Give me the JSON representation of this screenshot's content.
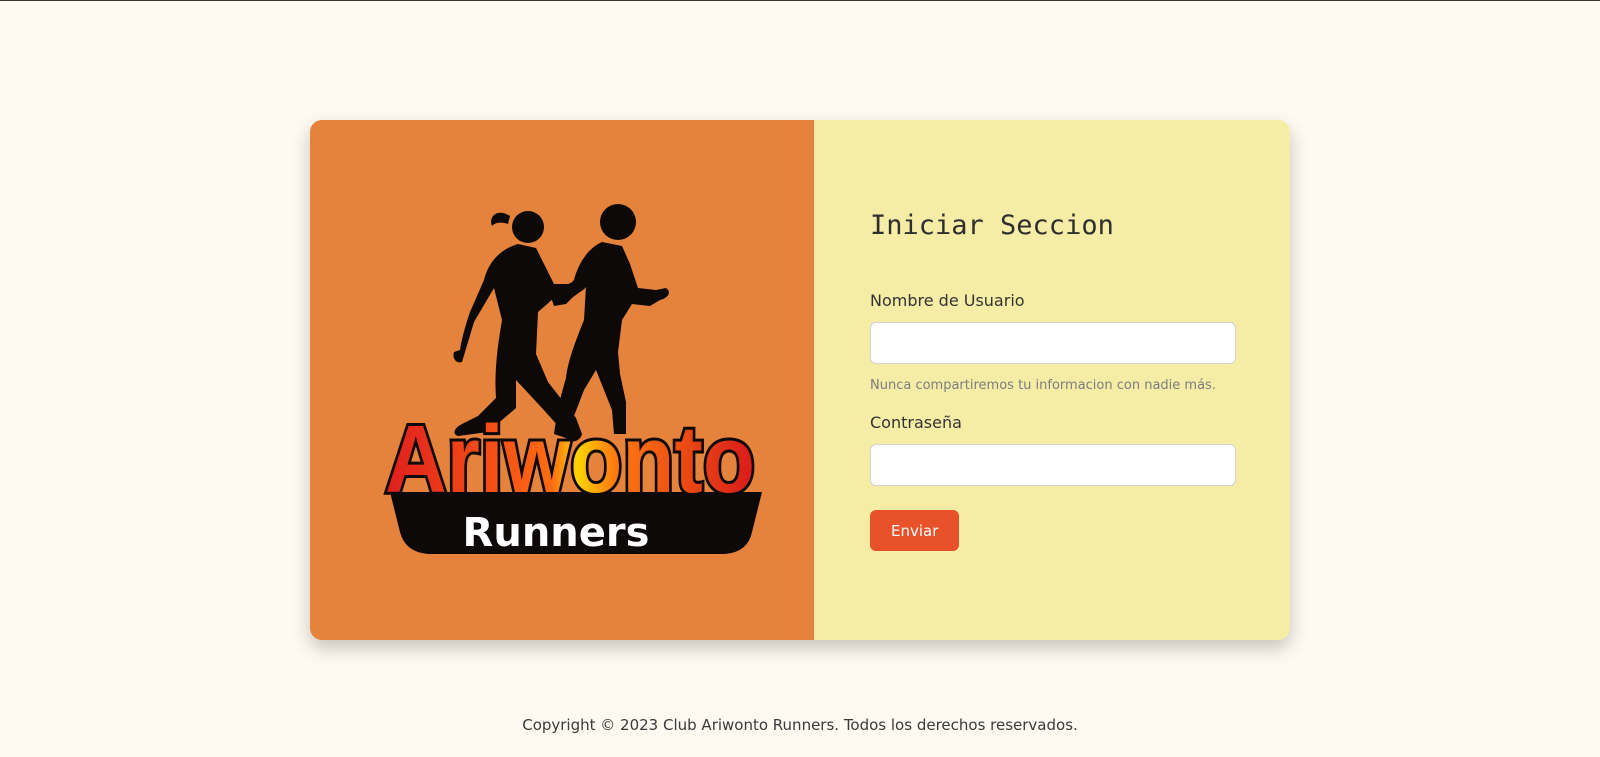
{
  "logo": {
    "brand_line1": "Ariwonto",
    "brand_line2": "Runners"
  },
  "login": {
    "title": "Iniciar Seccion",
    "username_label": "Nombre de Usuario",
    "username_value": "",
    "username_help": "Nunca compartiremos tu informacion con nadie más.",
    "password_label": "Contraseña",
    "password_value": "",
    "submit_label": "Enviar"
  },
  "footer": {
    "copyright": "Copyright © 2023 Club Ariwonto Runners. Todos los derechos reservados."
  },
  "colors": {
    "page_background": "#fef9f1",
    "left_panel": "#e5823b",
    "right_panel": "#f5eca6",
    "submit_button": "#e7522a"
  }
}
